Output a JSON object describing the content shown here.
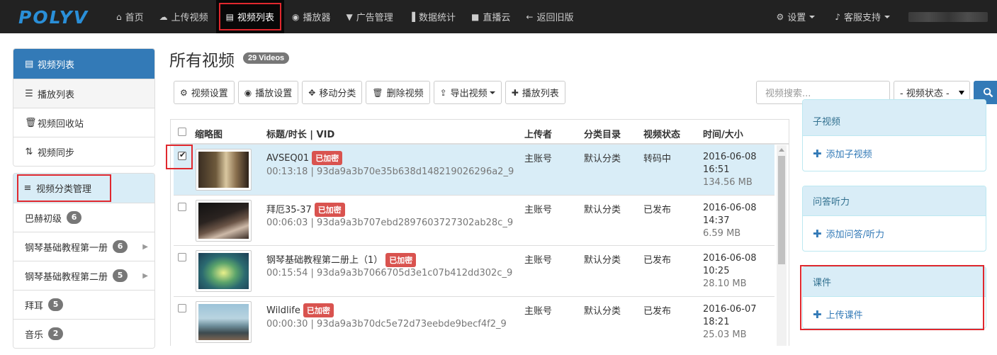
{
  "nav": {
    "logo": "POLYV",
    "items": [
      {
        "icon": "home-icon",
        "glyph": "⌂",
        "label": "首页"
      },
      {
        "icon": "upload-icon",
        "glyph": "☁",
        "label": "上传视频"
      },
      {
        "icon": "film-icon",
        "glyph": "▤",
        "label": "视频列表"
      },
      {
        "icon": "play-circle-icon",
        "glyph": "◉",
        "label": "播放器"
      },
      {
        "icon": "filter-icon",
        "glyph": "▼",
        "label": "广告管理"
      },
      {
        "icon": "bar-chart-icon",
        "glyph": "▐",
        "label": "数据统计"
      },
      {
        "icon": "video-camera-icon",
        "glyph": "■",
        "label": "直播云"
      },
      {
        "icon": "arrow-left-icon",
        "glyph": "←",
        "label": "返回旧版"
      }
    ],
    "right": [
      {
        "icon": "gear-icon",
        "glyph": "⚙",
        "label": "设置"
      },
      {
        "icon": "bell-icon",
        "glyph": "♪",
        "label": "客服支持"
      }
    ]
  },
  "sidebar": {
    "group1": [
      {
        "icon": "film-icon",
        "glyph": "▤",
        "label": "视频列表"
      },
      {
        "icon": "list-icon",
        "glyph": "☰",
        "label": "播放列表"
      },
      {
        "icon": "trash-icon",
        "glyph": "🗑",
        "label": "视频回收站"
      },
      {
        "icon": "sync-icon",
        "glyph": "⇅",
        "label": "视频同步"
      }
    ],
    "group2": {
      "header": {
        "icon": "menu-icon",
        "glyph": "≡",
        "label": "视频分类管理"
      },
      "items": [
        {
          "label": "巴赫初级",
          "count": "6"
        },
        {
          "label": "钢琴基础教程第一册",
          "count": "6"
        },
        {
          "label": "钢琴基础教程第二册",
          "count": "5"
        },
        {
          "label": "拜耳",
          "count": "5"
        },
        {
          "label": "音乐",
          "count": "2"
        }
      ]
    }
  },
  "main": {
    "title": "所有视频",
    "count_badge": "29 Videos",
    "toolbar": [
      {
        "icon": "gear-icon",
        "glyph": "⚙",
        "label": "视频设置"
      },
      {
        "icon": "play-circle-icon",
        "glyph": "◉",
        "label": "播放设置"
      },
      {
        "icon": "move-icon",
        "glyph": "✥",
        "label": "移动分类"
      },
      {
        "icon": "trash-icon",
        "glyph": "🗑",
        "label": "删除视频"
      },
      {
        "icon": "export-icon",
        "glyph": "⇪",
        "label": "导出视频"
      },
      {
        "icon": "plus-icon",
        "glyph": "✚",
        "label": "播放列表"
      }
    ],
    "search_placeholder": "视频搜索...",
    "status_select": "- 视频状态 -",
    "columns": [
      "缩略图",
      "标题/时长 | VID",
      "上传者",
      "分类目录",
      "视频状态",
      "时间/大小"
    ],
    "rows": [
      {
        "title": "AVSEQ01",
        "enc": "已加密",
        "duration": "00:13:18",
        "vid": "93da9a3b70e35b638d148219026296a2_9",
        "uploader": "主账号",
        "category": "默认分类",
        "status": "转码中",
        "date": "2016-06-08",
        "time": "16:51",
        "size": "134.56 MB",
        "checked": true
      },
      {
        "title": "拜厄35-37",
        "enc": "已加密",
        "duration": "00:06:03",
        "vid": "93da9a3b707ebd2897603727302ab28c_9",
        "uploader": "主账号",
        "category": "默认分类",
        "status": "已发布",
        "date": "2016-06-08",
        "time": "14:37",
        "size": "6.59 MB",
        "checked": false
      },
      {
        "title": "钢琴基础教程第二册上（1）",
        "enc": "已加密",
        "duration": "00:15:54",
        "vid": "93da9a3b7066705d3e1c07b412dd302c_9",
        "uploader": "主账号",
        "category": "默认分类",
        "status": "已发布",
        "date": "2016-06-08",
        "time": "10:25",
        "size": "28.10 MB",
        "checked": false
      },
      {
        "title": "Wildlife",
        "enc": "已加密",
        "duration": "00:00:30",
        "vid": "93da9a3b70dc5e72d73eebde9becf4f2_9",
        "uploader": "主账号",
        "category": "默认分类",
        "status": "已发布",
        "date": "2016-06-07",
        "time": "18:21",
        "size": "25.03 MB",
        "checked": false
      }
    ]
  },
  "right_panels": [
    {
      "header": "子视频",
      "action": "添加子视频"
    },
    {
      "header": "问答听力",
      "action": "添加问答/听力"
    },
    {
      "header": "课件",
      "action": "上传课件"
    }
  ]
}
